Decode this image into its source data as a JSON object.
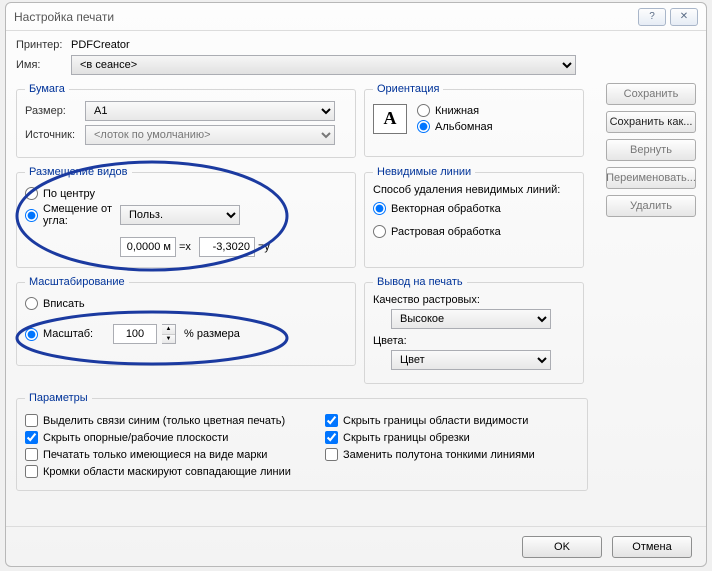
{
  "title": "Настройка печати",
  "printer_label": "Принтер:",
  "printer_value": "PDFCreator",
  "name_label": "Имя:",
  "name_value": "<в сеансе>",
  "buttons": {
    "save": "Сохранить",
    "save_as": "Сохранить как...",
    "revert": "Вернуть",
    "rename": "Переименовать...",
    "delete": "Удалить",
    "ok": "OK",
    "cancel": "Отмена"
  },
  "paper": {
    "legend": "Бумага",
    "size_label": "Размер:",
    "size_value": "A1",
    "source_label": "Источник:",
    "source_value": "<лоток по умолчанию>"
  },
  "orientation": {
    "legend": "Ориентация",
    "portrait": "Книжная",
    "landscape": "Альбомная"
  },
  "placement": {
    "legend": "Размещение видов",
    "center": "По центру",
    "offset": "Смещение от угла:",
    "offset_select": "Польз.",
    "x_value": "0,0000 м",
    "x_suffix": "=x",
    "y_value": "-3,3020",
    "y_suffix": "=y"
  },
  "hidden": {
    "legend": "Невидимые линии",
    "method_label": "Способ удаления невидимых линий:",
    "vector": "Векторная обработка",
    "raster": "Растровая обработка"
  },
  "zoom": {
    "legend": "Масштабирование",
    "fit": "Вписать",
    "zoom_label": "Масштаб:",
    "zoom_value": "100",
    "zoom_suffix": "% размера"
  },
  "appearance": {
    "legend": "Вывод на печать",
    "raster_q_label": "Качество растровых:",
    "raster_q_value": "Высокое",
    "color_label": "Цвета:",
    "color_value": "Цвет"
  },
  "options": {
    "legend": "Параметры",
    "c1": "Выделить связи синим (только цветная печать)",
    "c2": "Скрыть опорные/рабочие плоскости",
    "c3": "Печатать только имеющиеся на виде марки",
    "c4": "Кромки области маскируют совпадающие линии",
    "c5": "Скрыть границы области видимости",
    "c6": "Скрыть границы обрезки",
    "c7": "Заменить полутона тонкими линиями"
  }
}
